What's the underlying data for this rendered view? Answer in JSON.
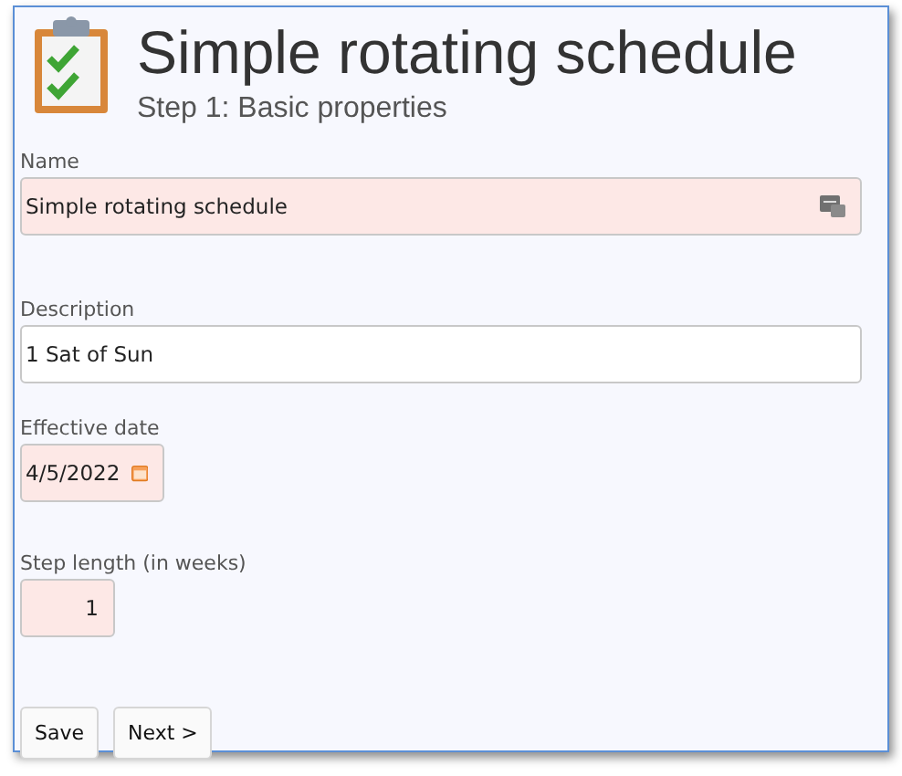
{
  "header": {
    "title": "Simple rotating schedule",
    "subtitle": "Step 1: Basic properties"
  },
  "fields": [
    {
      "label": "Name",
      "value": "Simple rotating schedule",
      "kind": "lookup",
      "required": true
    },
    {
      "label": "Description",
      "value": "1 Sat of Sun",
      "kind": "text",
      "required": false
    },
    {
      "label": "Effective date",
      "value": "4/5/2022",
      "kind": "date",
      "required": true
    },
    {
      "label": "Step length (in weeks)",
      "value": "1",
      "kind": "number",
      "required": true
    }
  ],
  "buttons": [
    "Save",
    "Next >"
  ]
}
